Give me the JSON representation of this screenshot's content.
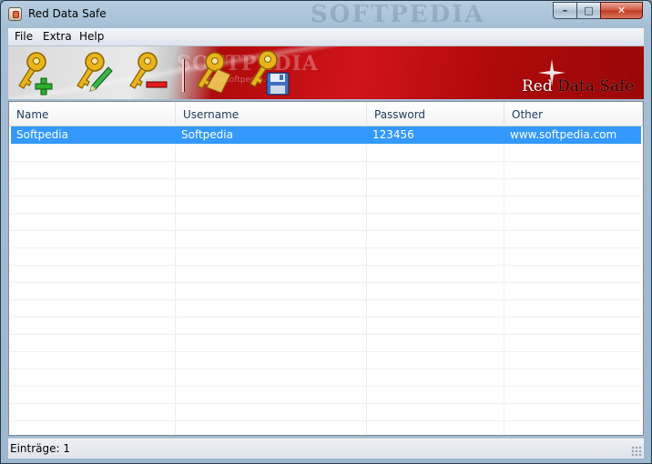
{
  "window": {
    "title": "Red Data Safe",
    "title_watermark": "SOFTPEDIA",
    "buttons": {
      "minimize": "–",
      "maximize": "□",
      "close": "✕"
    }
  },
  "menu": {
    "items": [
      {
        "label": "File"
      },
      {
        "label": "Extra"
      },
      {
        "label": "Help"
      }
    ]
  },
  "toolbar": {
    "watermark": "SOFTPEDIA",
    "watermark_small": "www.softpedia.com",
    "brand_red": "Red",
    "brand_rest": " Data Safe",
    "buttons": [
      {
        "icon": "key-add-icon"
      },
      {
        "icon": "key-edit-icon"
      },
      {
        "icon": "key-remove-icon"
      },
      {
        "icon": "key-copy-icon"
      },
      {
        "icon": "key-save-icon"
      }
    ],
    "colors": {
      "key_gold": "#e8b41c",
      "band_red": "#c0101a"
    }
  },
  "table": {
    "columns": [
      "Name",
      "Username",
      "Password",
      "Other"
    ],
    "rows": [
      {
        "name": "Softpedia",
        "username": "Softpedia",
        "password": "123456",
        "other": "www.softpedia.com",
        "selected": true
      }
    ],
    "selection_color": "#3399ff"
  },
  "status": {
    "text": "Einträge: 1"
  }
}
